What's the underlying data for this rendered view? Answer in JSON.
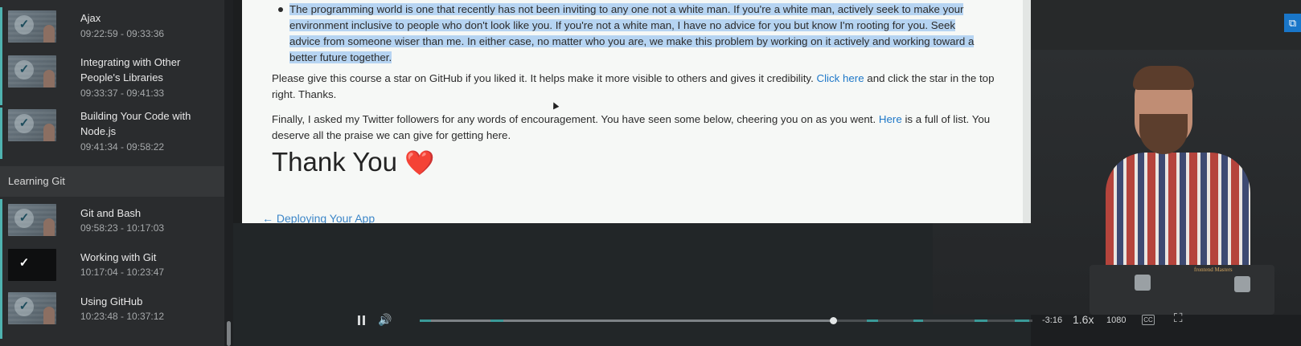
{
  "sidebar": {
    "lessons_top": [
      {
        "title": "Ajax",
        "time": "09:22:59 - 09:33:36"
      },
      {
        "title": "Integrating with Other People's Libraries",
        "time": "09:33:37 - 09:41:33"
      },
      {
        "title": "Building Your Code with Node.js",
        "time": "09:41:34 - 09:58:22"
      }
    ],
    "section_title": "Learning Git",
    "lessons_bottom": [
      {
        "title": "Git and Bash",
        "time": "09:58:23 - 10:17:03"
      },
      {
        "title": "Working with Git",
        "time": "10:17:04 - 10:23:47"
      },
      {
        "title": "Using GitHub",
        "time": "10:23:48 - 10:37:12"
      }
    ],
    "check_glyph": "✓"
  },
  "slide": {
    "bullet_text": "The programming world is one that recently has not been inviting to any one not a white man. If you're a white man, actively seek to make your environment inclusive to people who don't look like you. If you're not a white man, I have no advice for you but know I'm rooting for you. Seek advice from someone wiser than me. In either case, no matter who you are, we make this problem by working on it actively and working toward a better future together.",
    "para1_before": "Please give this course a star on GitHub if you liked it. It helps make it more visible to others and gives it credibility.",
    "para1_link": "Click here",
    "para1_after": "and click the star in the top right. Thanks.",
    "para2_before": "Finally, I asked my Twitter followers for any words of encouragement. You have seen some below, cheering you on as you went.",
    "para2_link": "Here",
    "para2_after": "is a full of list. You deserve all the praise we can give for getting here.",
    "heading": "Thank You",
    "heading_emoji": "❤️",
    "prev_link": "← Deploying Your App"
  },
  "video": {
    "laptop_brand": "frontend Masters",
    "cast_icon": "⧉"
  },
  "controls": {
    "time_remaining": "-3:16",
    "speed": "1.6x",
    "quality": "1080",
    "cc_label": "CC",
    "progress_fraction": 0.675,
    "volume_icon": "🔊",
    "fullscreen_icon": "⛶"
  }
}
